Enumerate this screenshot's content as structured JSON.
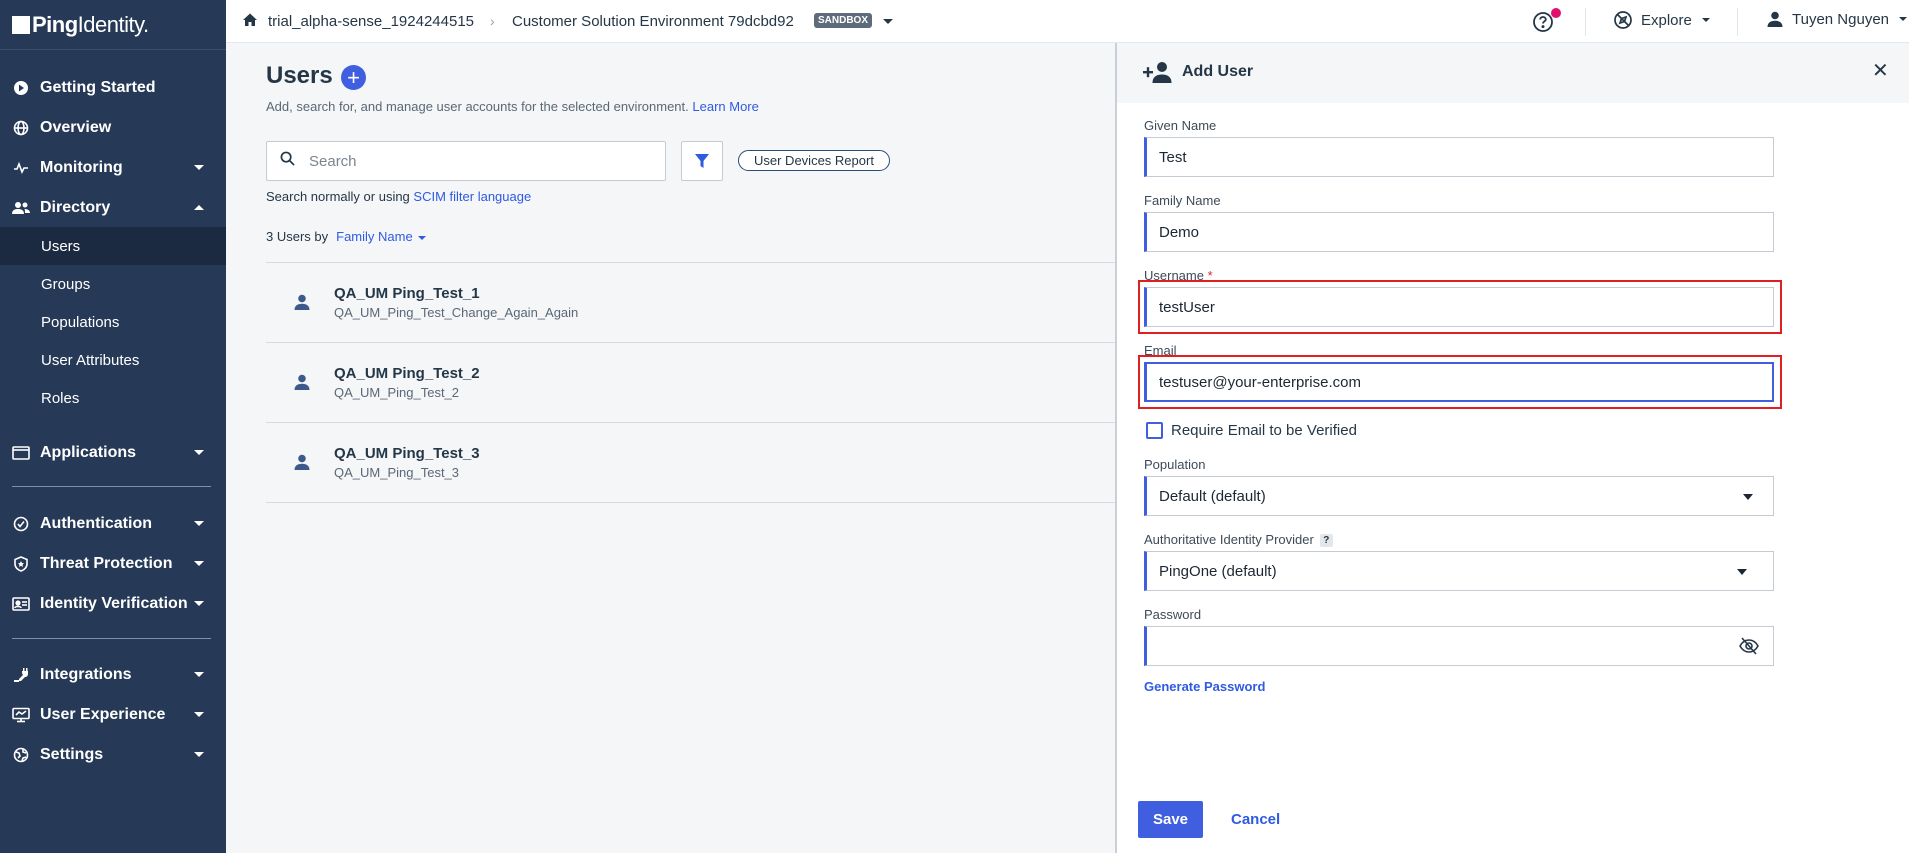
{
  "brand": {
    "logo_bold": "Ping",
    "logo_light": "Identity."
  },
  "header": {
    "org": "trial_alpha-sense_1924244515",
    "environment": "Customer Solution Environment 79dcbd92",
    "env_badge": "SANDBOX",
    "explore_label": "Explore",
    "user_name": "Tuyen Nguyen"
  },
  "sidebar": {
    "items": [
      {
        "label": "Getting Started",
        "icon": "play-icon"
      },
      {
        "label": "Overview",
        "icon": "globe-icon"
      },
      {
        "label": "Monitoring",
        "icon": "pulse-icon"
      },
      {
        "label": "Directory",
        "icon": "people-icon"
      },
      {
        "label": "Applications",
        "icon": "window-icon"
      },
      {
        "label": "Authentication",
        "icon": "check-circle-icon"
      },
      {
        "label": "Threat Protection",
        "icon": "shield-icon"
      },
      {
        "label": "Identity Verification",
        "icon": "id-card-icon"
      },
      {
        "label": "Integrations",
        "icon": "plug-icon"
      },
      {
        "label": "User Experience",
        "icon": "monitor-icon"
      },
      {
        "label": "Settings",
        "icon": "globe-gear-icon"
      }
    ],
    "directory_sub": [
      "Users",
      "Groups",
      "Populations",
      "User Attributes",
      "Roles"
    ]
  },
  "users_page": {
    "title": "Users",
    "description": "Add, search for, and manage user accounts for the selected environment.",
    "learn_more": "Learn More",
    "search_placeholder": "Search",
    "report_button": "User Devices Report",
    "search_hint": "Search normally or using",
    "scim_link": "SCIM filter language",
    "count_text": "3 Users by",
    "sort_field": "Family Name",
    "users": [
      {
        "name": "QA_UM Ping_Test_1",
        "sub": "QA_UM_Ping_Test_Change_Again_Again"
      },
      {
        "name": "QA_UM Ping_Test_2",
        "sub": "QA_UM_Ping_Test_2"
      },
      {
        "name": "QA_UM Ping_Test_3",
        "sub": "QA_UM_Ping_Test_3"
      }
    ]
  },
  "add_user": {
    "title": "Add User",
    "given_name_label": "Given Name",
    "given_name": "Test",
    "family_name_label": "Family Name",
    "family_name": "Demo",
    "username_label": "Username",
    "required_mark": "*",
    "username": "testUser",
    "email_label": "Email",
    "email": "testuser@your-enterprise.com",
    "require_email_label": "Require Email to be Verified",
    "require_email_checked": false,
    "population_label": "Population",
    "population": "Default (default)",
    "idp_label": "Authoritative Identity Provider",
    "idp_help": "?",
    "idp": "PingOne (default)",
    "password_label": "Password",
    "password": "",
    "generate_password": "Generate Password",
    "save": "Save",
    "cancel": "Cancel"
  },
  "colors": {
    "sidebar_bg": "#263956",
    "accent": "#3f5fe0",
    "highlight": "#e02020",
    "notification": "#e0116e"
  }
}
